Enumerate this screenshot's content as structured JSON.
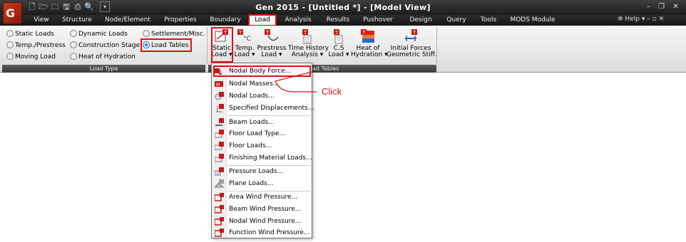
{
  "app": {
    "title": "Gen 2015 - [Untitled *] - [Model View]",
    "logo_letter": "G"
  },
  "quick_access": {
    "icons": [
      "new-file-icon",
      "open-folder-icon",
      "open-recent-icon",
      "save-icon",
      "print-icon",
      "print-preview-icon"
    ],
    "customize_glyph": "▾"
  },
  "menu": {
    "items": [
      "View",
      "Structure",
      "Node/Element",
      "Properties",
      "Boundary",
      "Load",
      "Analysis",
      "Results",
      "Pushover",
      "Design",
      "Query",
      "Tools",
      "MODS Module"
    ],
    "active": "Load",
    "help_label": "Help"
  },
  "ribbon": {
    "load_type": {
      "footer": "Load Type",
      "options": [
        {
          "label": "Static Loads",
          "selected": false
        },
        {
          "label": "Temp./Prestress",
          "selected": false
        },
        {
          "label": "Moving Load",
          "selected": false
        },
        {
          "label": "Dynamic Loads",
          "selected": false
        },
        {
          "label": "Construction Stage",
          "selected": false
        },
        {
          "label": "Heat of Hydration",
          "selected": false
        },
        {
          "label": "Settlement/Misc.",
          "selected": false
        },
        {
          "label": "Load Tables",
          "selected": true
        }
      ]
    },
    "load_tables": {
      "footer": "Load Tables",
      "buttons": [
        {
          "line1": "Static",
          "line2": "Load ▾",
          "icon": "static-load-table-icon"
        },
        {
          "line1": "Temp.",
          "line2": "Load ▾",
          "icon": "temperature-load-icon"
        },
        {
          "line1": "Prestress",
          "line2": "Load ▾",
          "icon": "prestress-load-icon"
        },
        {
          "line1": "Time History",
          "line2": "Analysis ▾",
          "icon": "time-history-icon"
        },
        {
          "line1": "C.S",
          "line2": "Load ▾",
          "icon": "construction-stage-load-icon"
        },
        {
          "line1": "Heat of",
          "line2": "Hydration ▾",
          "icon": "heat-of-hydration-icon"
        },
        {
          "line1": "Initial Forces",
          "line2": "Geometric Stiff.",
          "icon": "initial-forces-icon"
        }
      ]
    }
  },
  "dropdown": {
    "items": [
      {
        "label": "Nodal Body Force...",
        "highlighted": true
      },
      {
        "label": "Nodal Masses..."
      },
      {
        "label": "Nodal Loads..."
      },
      {
        "label": "Specified Displacements..."
      },
      {
        "label": "Beam Loads..."
      },
      {
        "label": "Floor Load Type..."
      },
      {
        "label": "Floor Loads..."
      },
      {
        "label": "Finishing Material Loads..."
      },
      {
        "label": "Pressure Loads..."
      },
      {
        "label": "Plane Loads..."
      },
      {
        "label": "Area Wind Pressure..."
      },
      {
        "label": "Beam Wind Pressure..."
      },
      {
        "label": "Nodal Wind Pressure..."
      },
      {
        "label": "Function Wind Pressure..."
      }
    ]
  },
  "annotation": {
    "click_label": "Click",
    "color": "#d8101a"
  },
  "colors": {
    "highlight": "#e01010",
    "titlebar": "#2a2a2a",
    "ribbon": "#ececec"
  }
}
